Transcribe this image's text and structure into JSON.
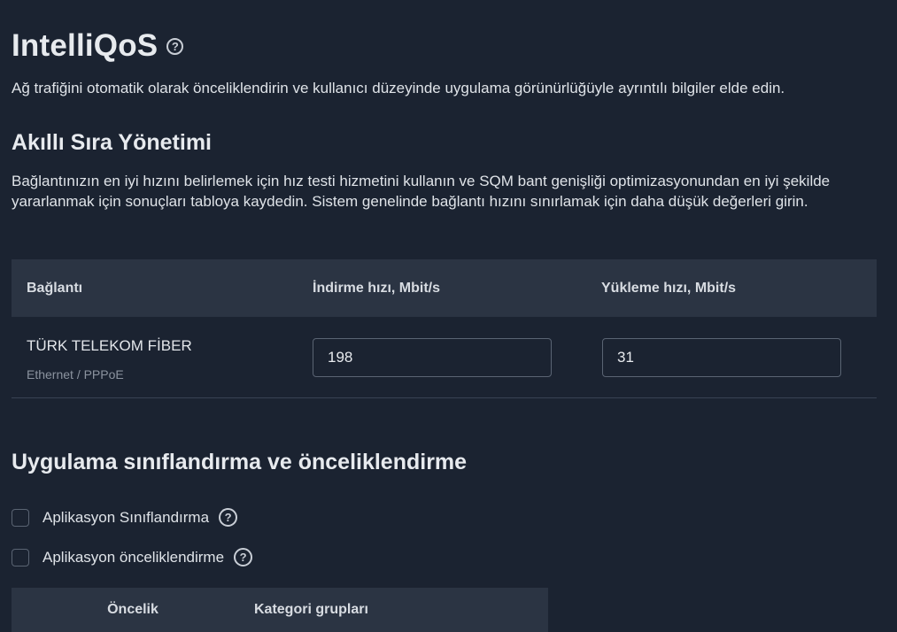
{
  "header": {
    "title": "IntelliQoS",
    "help_icon": "question-circle-icon",
    "subtitle": "Ağ trafiğini otomatik olarak önceliklendirin ve kullanıcı düzeyinde uygulama görünürlüğüyle ayrıntılı bilgiler elde edin."
  },
  "sqm": {
    "title": "Akıllı Sıra Yönetimi",
    "description": "Bağlantınızın en iyi hızını belirlemek için hız testi hizmetini kullanın ve SQM bant genişliği optimizasyonundan en iyi şekilde yararlanmak için sonuçları tabloya kaydedin. Sistem genelinde bağlantı hızını sınırlamak için daha düşük değerleri girin.",
    "table": {
      "headers": {
        "connection": "Bağlantı",
        "download": "İndirme hızı, Mbit/s",
        "upload": "Yükleme hızı, Mbit/s"
      },
      "rows": [
        {
          "name": "TÜRK TELEKOM FİBER",
          "type": "Ethernet / PPPoE",
          "download": "198",
          "upload": "31"
        }
      ]
    }
  },
  "app_classification": {
    "title": "Uygulama sınıflandırma ve önceliklendirme",
    "options": [
      {
        "label": "Aplikasyon Sınıflandırma",
        "checked": false
      },
      {
        "label": "Aplikasyon önceliklendirme",
        "checked": false
      }
    ],
    "priority_table": {
      "headers": {
        "priority": "Öncelik",
        "categories": "Kategori grupları"
      }
    }
  },
  "colors": {
    "background": "#1b2331",
    "table_header": "#2b3443",
    "border": "#5a6473"
  }
}
